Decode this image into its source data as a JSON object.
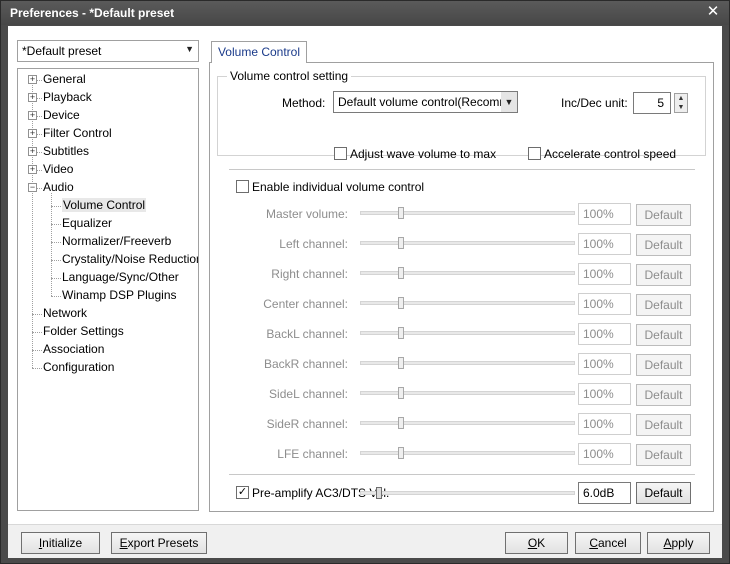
{
  "window": {
    "title": "Preferences - *Default preset",
    "close_glyph": "✕"
  },
  "preset_selector": {
    "value": "*Default preset"
  },
  "tree": {
    "items": [
      {
        "label": "General",
        "expandable": true
      },
      {
        "label": "Playback",
        "expandable": true
      },
      {
        "label": "Device",
        "expandable": true
      },
      {
        "label": "Filter Control",
        "expandable": true
      },
      {
        "label": "Subtitles",
        "expandable": true
      },
      {
        "label": "Video",
        "expandable": true
      },
      {
        "label": "Audio",
        "expandable": true,
        "expanded": true
      },
      {
        "label": "Volume Control",
        "child": true,
        "selected": true
      },
      {
        "label": "Equalizer",
        "child": true
      },
      {
        "label": "Normalizer/Freeverb",
        "child": true
      },
      {
        "label": "Crystality/Noise Reduction",
        "child": true
      },
      {
        "label": "Language/Sync/Other",
        "child": true
      },
      {
        "label": "Winamp DSP Plugins",
        "child": true
      },
      {
        "label": "Network"
      },
      {
        "label": "Folder Settings"
      },
      {
        "label": "Association"
      },
      {
        "label": "Configuration"
      }
    ]
  },
  "tab": {
    "label": "Volume Control"
  },
  "volume_setting": {
    "group_label": "Volume control setting",
    "method_label": "Method:",
    "method_value": "Default volume control(Recommended)",
    "incdec_label": "Inc/Dec unit:",
    "incdec_value": "5",
    "adjust_wave_label": "Adjust wave volume to max",
    "adjust_wave_checked": false,
    "accelerate_label": "Accelerate control speed",
    "accelerate_checked": false
  },
  "individual": {
    "enable_label": "Enable individual volume control",
    "enable_checked": false,
    "default_label": "Default",
    "channels": [
      {
        "label": "Master volume:",
        "value": "100%",
        "level": 0.19
      },
      {
        "label": "Left channel:",
        "value": "100%",
        "level": 0.19
      },
      {
        "label": "Right channel:",
        "value": "100%",
        "level": 0.19
      },
      {
        "label": "Center channel:",
        "value": "100%",
        "level": 0.19
      },
      {
        "label": "BackL channel:",
        "value": "100%",
        "level": 0.19
      },
      {
        "label": "BackR channel:",
        "value": "100%",
        "level": 0.19
      },
      {
        "label": "SideL channel:",
        "value": "100%",
        "level": 0.19
      },
      {
        "label": "SideR channel:",
        "value": "100%",
        "level": 0.19
      },
      {
        "label": "LFE channel:",
        "value": "100%",
        "level": 0.19
      }
    ]
  },
  "preamp": {
    "label": "Pre-amplify AC3/DTS Vol.",
    "checked": true,
    "value": "6.0dB",
    "level": 0.09,
    "default_label": "Default"
  },
  "bottom_buttons": {
    "initialize_prefix": "",
    "initialize_mnemonic": "I",
    "initialize_rest": "nitialize",
    "export_prefix": "",
    "export_mnemonic": "E",
    "export_rest": "xport Presets",
    "ok_mnemonic": "O",
    "ok_rest": "K",
    "cancel_mnemonic": "C",
    "cancel_rest": "ancel",
    "apply_mnemonic": "A",
    "apply_rest": "pply"
  },
  "colors": {
    "titlebar": "#4a4a4a",
    "highlight": "#ffff80",
    "tab_text": "#1a3a8a"
  }
}
